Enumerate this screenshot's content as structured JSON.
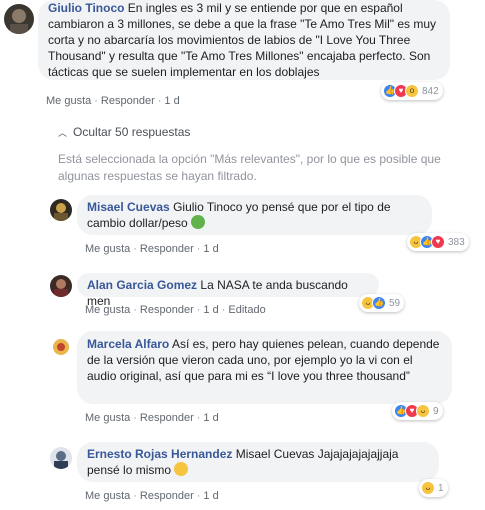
{
  "main_comment": {
    "author": "Giulio Tinoco",
    "text": "En ingles es 3 mil y se entiende por que en español cambiaron a 3 millones, se debe a que la frase \"Te Amo Tres Mil\" es muy corta y no abarcaría los movimientos de labios de \"I Love You Three Thousand\" y resulta que \"Te Amo Tres Millones\" encajaba perfecto. Son tácticas que se suelen implementar en los doblajes",
    "like_label": "Me gusta",
    "reply_label": "Responder",
    "time": "1 d",
    "reaction_count": "842",
    "reactions": [
      "like-icon",
      "love-icon",
      "wow-icon"
    ]
  },
  "replies_toggle": {
    "label": "Ocultar 50 respuestas"
  },
  "filter_notice": "Está seleccionada la opción \"Más relevantes\", por lo que es posible que algunas respuestas se hayan filtrado.",
  "replies": [
    {
      "author": "Misael Cuevas",
      "text": "Giulio Tinoco yo pensé que por el tipo de cambio dollar/peso",
      "emoji": "money-mouth-emoji",
      "like_label": "Me gusta",
      "reply_label": "Responder",
      "time": "1 d",
      "reaction_count": "383",
      "reactions": [
        "haha-icon",
        "like-icon",
        "love-icon"
      ]
    },
    {
      "author": "Alan Garcia Gomez",
      "text": "La NASA te anda buscando men",
      "like_label": "Me gusta",
      "reply_label": "Responder",
      "time": "1 d",
      "edited": "Editado",
      "reaction_count": "59",
      "reactions": [
        "haha-icon",
        "like-icon"
      ]
    },
    {
      "author": "Marcela Alfaro",
      "text": "Así es, pero hay quienes pelean, cuando depende de la versión que vieron cada uno, por ejemplo yo la vi con el audio original, así que para mi es “I love you three thousand”",
      "like_label": "Me gusta",
      "reply_label": "Responder",
      "time": "1 d",
      "reaction_count": "9",
      "reactions": [
        "like-icon",
        "love-icon",
        "haha-icon"
      ]
    },
    {
      "author": "Ernesto Rojas Hernandez",
      "text": "Misael Cuevas Jajajajajajajjaja pensé lo mismo",
      "emoji": "laughing-emoji",
      "like_label": "Me gusta",
      "reply_label": "Responder",
      "time": "1 d",
      "reaction_count": "1",
      "reactions": [
        "haha-icon"
      ]
    }
  ],
  "colors": {
    "name": "#385898",
    "bubble": "#f2f3f5",
    "meta": "#616770",
    "like": "#3b84f5",
    "love": "#f0384f",
    "haha": "#f7c440"
  }
}
